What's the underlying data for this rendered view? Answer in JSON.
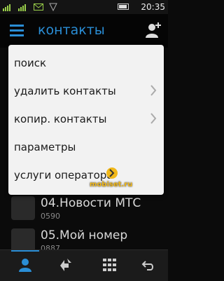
{
  "status_bar": {
    "time": "20:35"
  },
  "header": {
    "title": "контакты"
  },
  "menu": {
    "items": [
      {
        "label": "поиск",
        "has_submenu": false
      },
      {
        "label": "удалить контакты",
        "has_submenu": true
      },
      {
        "label": "копир. контакты",
        "has_submenu": true
      },
      {
        "label": "параметры",
        "has_submenu": false
      },
      {
        "label": "услуги оператора",
        "has_submenu": false
      }
    ]
  },
  "background_list": [
    {
      "name": "04.Новости МТС",
      "number": "0590"
    },
    {
      "name": "05.Мой номер",
      "number": "0887"
    }
  ],
  "watermark": "mobiset.ru",
  "colors": {
    "accent": "#2a8ed6",
    "menu_bg": "#f2f2f2",
    "watermark": "#f1b81a"
  },
  "icons": [
    "menu-icon",
    "add-contact-icon",
    "contacts-icon",
    "call-log-icon",
    "dialpad-icon",
    "back-icon"
  ]
}
